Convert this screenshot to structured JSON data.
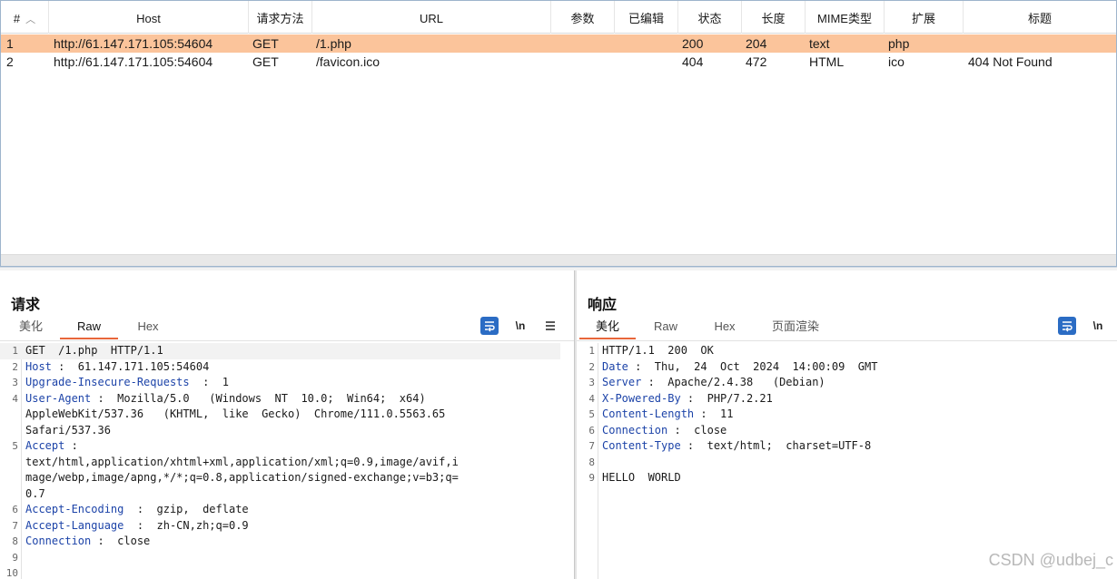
{
  "history": {
    "columns": [
      "#",
      "Host",
      "请求方法",
      "URL",
      "参数",
      "已编辑",
      "状态",
      "长度",
      "MIME类型",
      "扩展",
      "标题"
    ],
    "rows": [
      {
        "id": "1",
        "host": "http://61.147.171.105:54604",
        "method": "GET",
        "url": "/1.php",
        "params": "",
        "edited": "",
        "status": "200",
        "length": "204",
        "mime": "text",
        "ext": "php",
        "title": ""
      },
      {
        "id": "2",
        "host": "http://61.147.171.105:54604",
        "method": "GET",
        "url": "/favicon.ico",
        "params": "",
        "edited": "",
        "status": "404",
        "length": "472",
        "mime": "HTML",
        "ext": "ico",
        "title": "404 Not Found"
      }
    ],
    "selected_row": 1,
    "colors": {
      "selected": "#fbc49b"
    }
  },
  "request": {
    "title": "请求",
    "tabs": [
      "美化",
      "Raw",
      "Hex"
    ],
    "active_tab": "Raw",
    "tools": {
      "wrap_icon": "wrap-icon",
      "newline_label": "\\n",
      "menu_icon": "menu-icon"
    },
    "lines": [
      {
        "n": "1",
        "key": "",
        "text": "GET  /1.php  HTTP/1.1"
      },
      {
        "n": "2",
        "key": "Host",
        "text": " :  61.147.171.105:54604"
      },
      {
        "n": "3",
        "key": "Upgrade-Insecure-Requests",
        "text": "  :  1"
      },
      {
        "n": "4",
        "key": "User-Agent",
        "text": " :  Mozilla/5.0   (Windows  NT  10.0;  Win64;  x64)"
      },
      {
        "n": "",
        "key": "",
        "text": "AppleWebKit/537.36   (KHTML,  like  Gecko)  Chrome/111.0.5563.65"
      },
      {
        "n": "",
        "key": "",
        "text": "Safari/537.36"
      },
      {
        "n": "5",
        "key": "Accept",
        "text": " :"
      },
      {
        "n": "",
        "key": "",
        "text": "text/html,application/xhtml+xml,application/xml;q=0.9,image/avif,i"
      },
      {
        "n": "",
        "key": "",
        "text": "mage/webp,image/apng,*/*;q=0.8,application/signed-exchange;v=b3;q="
      },
      {
        "n": "",
        "key": "",
        "text": "0.7"
      },
      {
        "n": "6",
        "key": "Accept-Encoding",
        "text": "  :  gzip,  deflate"
      },
      {
        "n": "7",
        "key": "Accept-Language",
        "text": "  :  zh-CN,zh;q=0.9"
      },
      {
        "n": "8",
        "key": "Connection",
        "text": " :  close"
      },
      {
        "n": "9",
        "key": "",
        "text": ""
      },
      {
        "n": "10",
        "key": "",
        "text": ""
      }
    ]
  },
  "response": {
    "title": "响应",
    "tabs": [
      "美化",
      "Raw",
      "Hex",
      "页面渲染"
    ],
    "active_tab": "美化",
    "tools": {
      "wrap_icon": "wrap-icon",
      "newline_label": "\\n"
    },
    "lines": [
      {
        "n": "1",
        "key": "",
        "text": "HTTP/1.1  200  OK"
      },
      {
        "n": "2",
        "key": "Date",
        "text": " :  Thu,  24  Oct  2024  14:00:09  GMT"
      },
      {
        "n": "3",
        "key": "Server",
        "text": " :  Apache/2.4.38   (Debian)"
      },
      {
        "n": "4",
        "key": "X-Powered-By",
        "text": " :  PHP/7.2.21"
      },
      {
        "n": "5",
        "key": "Content-Length",
        "text": " :  11"
      },
      {
        "n": "6",
        "key": "Connection",
        "text": " :  close"
      },
      {
        "n": "7",
        "key": "Content-Type",
        "text": " :  text/html;  charset=UTF-8"
      },
      {
        "n": "8",
        "key": "",
        "text": ""
      },
      {
        "n": "9",
        "key": "",
        "text": "HELLO  WORLD"
      }
    ]
  },
  "watermark": "CSDN @udbej_c"
}
